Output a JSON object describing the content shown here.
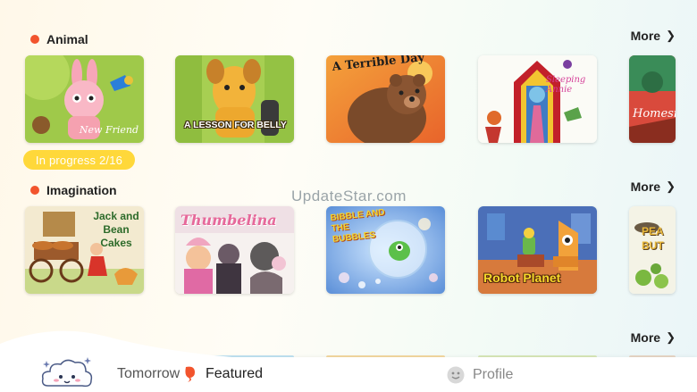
{
  "sections": [
    {
      "title": "Animal",
      "more_label": "More",
      "progress_label": "In progress 2/16",
      "cards": [
        {
          "title": "New Friend",
          "art": "bunny"
        },
        {
          "title": "A LESSON FOR BELLY",
          "art": "dog"
        },
        {
          "title": "A Terrible Day",
          "art": "bear"
        },
        {
          "title": "Sleeping Annie",
          "art": "annie"
        },
        {
          "title": "Homesi",
          "art": "home"
        }
      ]
    },
    {
      "title": "Imagination",
      "more_label": "More",
      "cards": [
        {
          "title": "Jack and Bean Cakes",
          "art": "jack"
        },
        {
          "title": "Thumbelina",
          "art": "thumb"
        },
        {
          "title": "BIBBLE AND THE BUBBLES",
          "art": "bubble"
        },
        {
          "title": "Robot Planet",
          "art": "robot"
        },
        {
          "title": "PEA BUT",
          "art": "pea"
        }
      ]
    },
    {
      "more_label": "More"
    }
  ],
  "watermark": "UpdateStar.com",
  "nav": {
    "tomorrow_label": "Tomorrow",
    "featured_label": "Featured",
    "profile_label": "Profile"
  },
  "colors": {
    "accent_dot": "#f2542d",
    "progress_bg": "#ffd83a",
    "featured_icon": "#f2542d"
  }
}
